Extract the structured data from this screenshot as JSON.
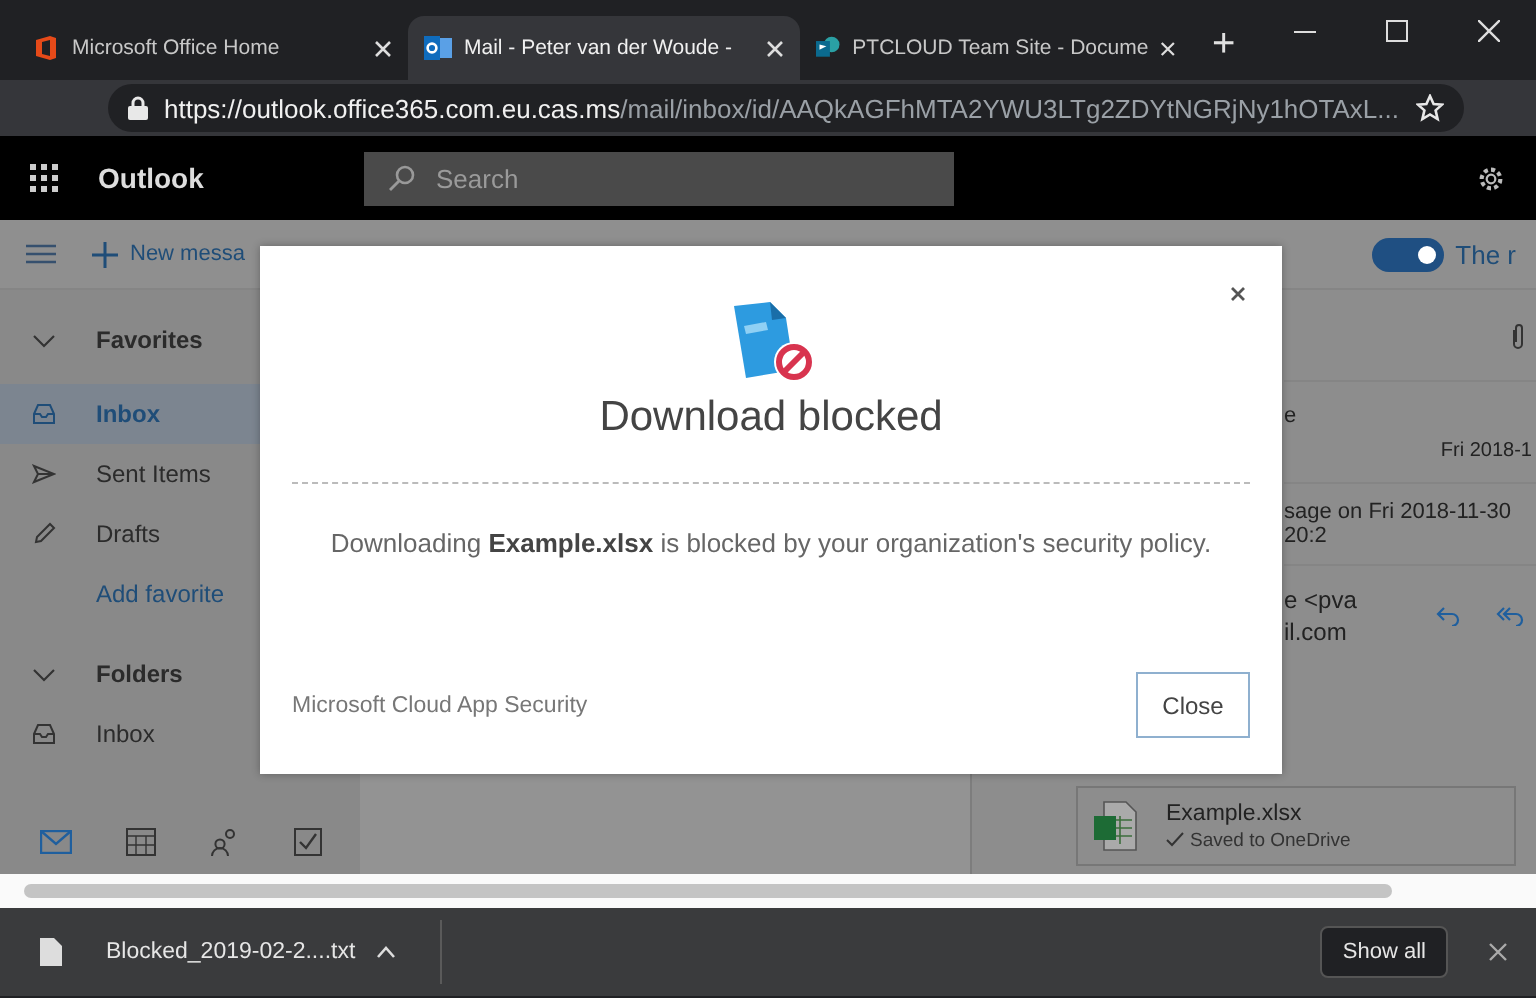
{
  "browser": {
    "tabs": [
      {
        "kind": "office",
        "title": "Microsoft Office Home",
        "selected": false
      },
      {
        "kind": "outlook",
        "title": "Mail - Peter van der Woude -",
        "selected": true
      },
      {
        "kind": "sharepoint",
        "title": "PTCLOUD Team Site - Docume",
        "selected": false
      }
    ],
    "new_tab": "+",
    "url_host": "https://outlook.office365.com.eu.cas.ms",
    "url_path": "/mail/inbox/id/AAQkAGFhMTA2YWU3LTg2ZDYtNGRjNy1hOTAxL..."
  },
  "header": {
    "app_name": "Outlook",
    "search": {
      "placeholder": "Search"
    }
  },
  "toolbar": {
    "new_message": "New messa",
    "toggle": {
      "on": true,
      "label": "The r"
    }
  },
  "nav": {
    "items": [
      {
        "kind": "section",
        "label": "Favorites",
        "expanded": true
      },
      {
        "kind": "inbox",
        "label": "Inbox",
        "selected": true
      },
      {
        "kind": "sent",
        "label": "Sent Items",
        "selected": false
      },
      {
        "kind": "drafts",
        "label": "Drafts",
        "selected": false
      },
      {
        "kind": "link",
        "label": "Add favorite"
      },
      {
        "kind": "section",
        "label": "Folders",
        "expanded": true
      },
      {
        "kind": "inbox",
        "label": "Inbox",
        "selected": false
      }
    ]
  },
  "bottom_nav": [
    {
      "kind": "mail",
      "selected": true
    },
    {
      "kind": "calendar",
      "selected": false
    },
    {
      "kind": "people",
      "selected": false
    },
    {
      "kind": "tasks",
      "selected": false
    }
  ],
  "reading_pane": {
    "subject_fragment": "e",
    "date": "Fri 2018-1",
    "info": "sage on Fri 2018-11-30 20:2",
    "from_line1": "e <pva",
    "from_line2": "il.com",
    "attachment": {
      "name": "Example.xlsx",
      "status": "Saved to OneDrive"
    }
  },
  "dialog": {
    "title": "Download blocked",
    "message": "Downloading **Example.xlsx** is blocked by your organization's security policy.",
    "footer": "Microsoft Cloud App Security",
    "button": "Close"
  },
  "download_bar": {
    "file": "Blocked_2019-02-2....txt",
    "show_all": "Show all"
  }
}
